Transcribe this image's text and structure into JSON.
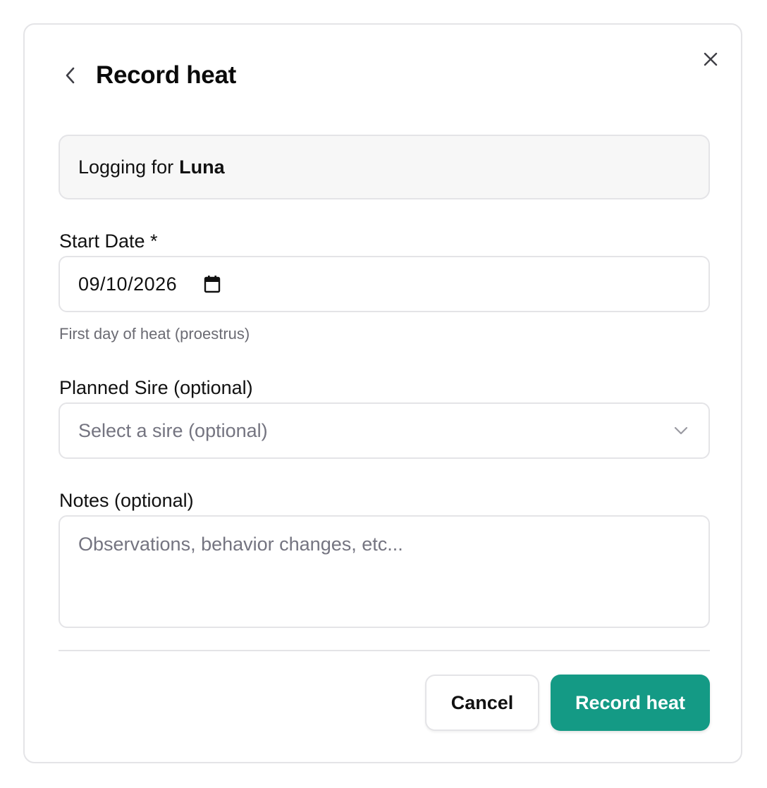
{
  "dialog": {
    "title": "Record heat",
    "back_icon": "chevron-left-icon",
    "close_icon": "close-icon"
  },
  "logging": {
    "prefix": "Logging for",
    "pet_name": "Luna"
  },
  "start_date": {
    "label": "Start Date *",
    "value": "09/10/2026",
    "icon": "calendar-icon",
    "hint": "First day of heat (proestrus)"
  },
  "sire": {
    "label": "Planned Sire (optional)",
    "placeholder": "Select a sire (optional)",
    "icon": "chevron-down-icon"
  },
  "notes": {
    "label": "Notes (optional)",
    "placeholder": "Observations, behavior changes, etc..."
  },
  "actions": {
    "cancel_label": "Cancel",
    "submit_label": "Record heat"
  },
  "colors": {
    "primary": "#149a85",
    "border": "#e4e4e7",
    "muted_text": "#6b6b73"
  }
}
